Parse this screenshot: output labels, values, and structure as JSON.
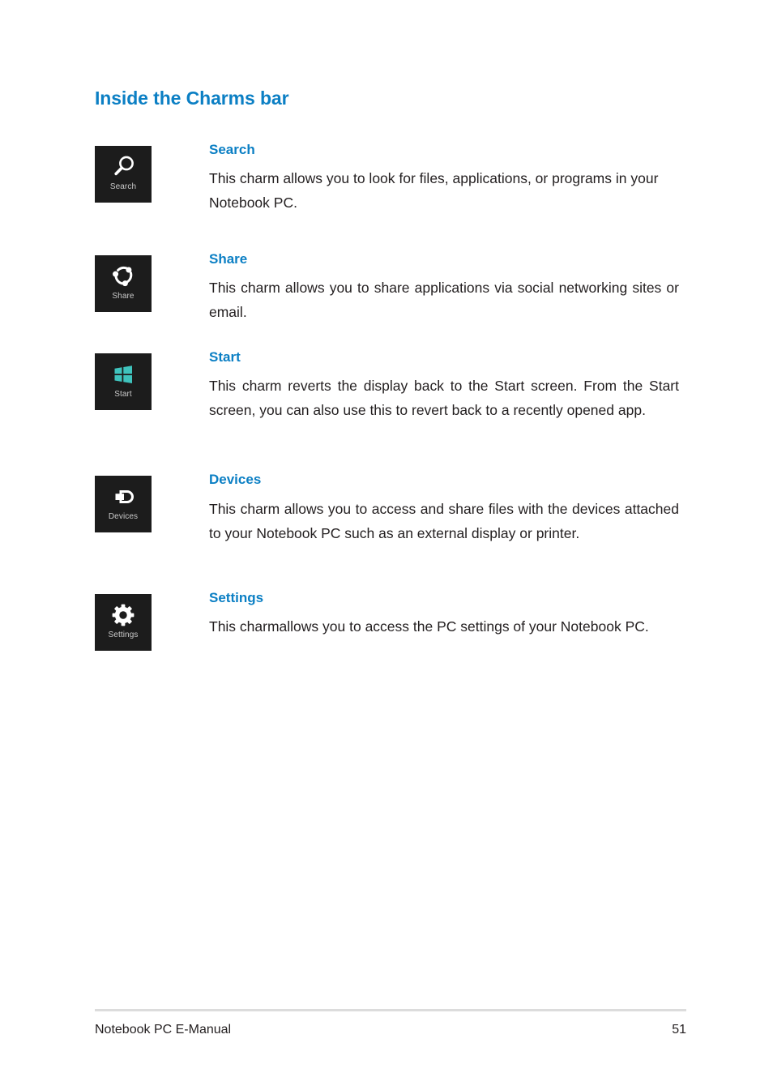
{
  "page": {
    "title": "Inside the Charms bar"
  },
  "charms": [
    {
      "icon": "search-icon",
      "tile_label": "Search",
      "heading": "Search",
      "body": "This charm allows you to look for files, applications, or programs in your Notebook PC."
    },
    {
      "icon": "share-icon",
      "tile_label": "Share",
      "heading": "Share",
      "body": "This charm allows you to share applications via social networking sites or email."
    },
    {
      "icon": "windows-start-icon",
      "tile_label": "Start",
      "heading": "Start",
      "body": "This charm reverts the display back to the Start screen. From the Start screen, you can also use this to revert back to a recently opened app."
    },
    {
      "icon": "devices-icon",
      "tile_label": "Devices",
      "heading": "Devices",
      "body": "This charm allows you to access and share files with the devices attached to your Notebook PC such as an external display or printer."
    },
    {
      "icon": "settings-gear-icon",
      "tile_label": "Settings",
      "heading": "Settings",
      "body": "This charmallows you to access the PC settings of your Notebook PC."
    }
  ],
  "footer": {
    "document_name": "Notebook PC E-Manual",
    "page_number": "51"
  },
  "colors": {
    "heading_blue": "#0b7fc4",
    "tile_background": "#1c1c1c",
    "tile_label_gray": "#c9c9c9",
    "windows_logo_teal": "#3fc3bd",
    "body_text": "#231f20",
    "footer_rule": "#dcdcdc"
  }
}
